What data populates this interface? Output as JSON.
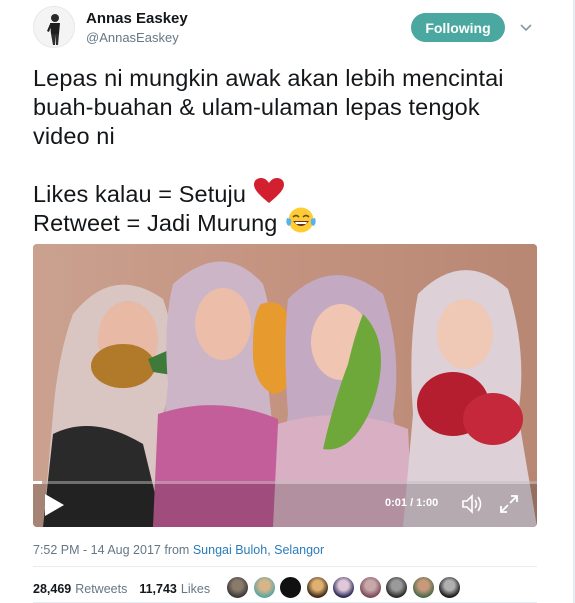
{
  "header": {
    "name": "Annas Easkey",
    "handle": "@AnnasEaskey",
    "follow_label": "Following"
  },
  "tweet": {
    "lines": [
      "Lepas ni mungkin awak akan lebih mencintai",
      "buah-buahan & ulam-ulaman lepas tengok",
      "video ni"
    ],
    "likes_line": "Likes kalau = Setuju",
    "retweet_line": "Retweet = Jadi Murung"
  },
  "video": {
    "time": "0:01 / 1:00",
    "progress": 0.017
  },
  "meta": {
    "timestamp": "7:52 PM - 14 Aug 2017 from ",
    "location": "Sungai Buloh, Selangor"
  },
  "stats": {
    "retweets_count": "28,469",
    "retweets_label": "Retweets",
    "likes_count": "11,743",
    "likes_label": "Likes"
  },
  "colors": {
    "follow_button": "#4aa8a0",
    "link": "#2b7bb9",
    "secondary_text": "#657786"
  },
  "icons": [
    "caret-down-icon",
    "heart-emoji-icon",
    "tears-of-joy-emoji-icon",
    "play-icon",
    "volume-icon",
    "fullscreen-icon"
  ]
}
